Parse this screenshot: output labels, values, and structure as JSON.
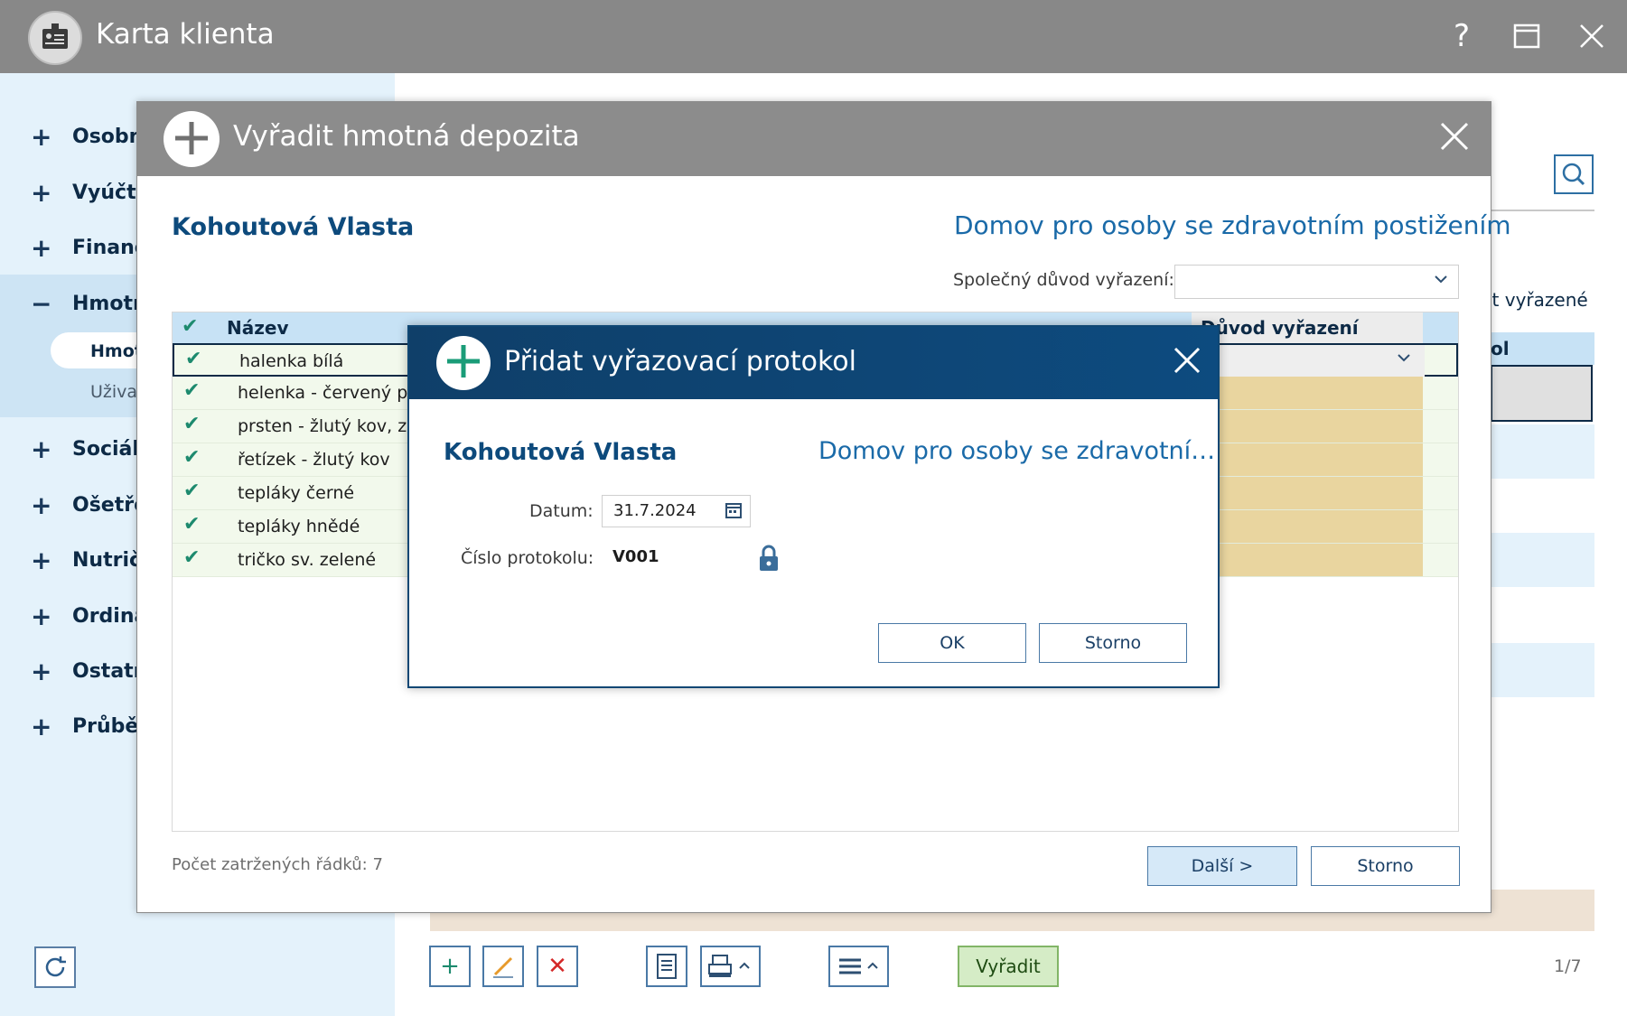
{
  "main_window": {
    "title": "Karta klienta",
    "help_label": "?",
    "maximize_label": "☐",
    "close_label": "✕",
    "pager": "1/7"
  },
  "sidebar": {
    "items": [
      {
        "sign": "+",
        "label": "Osobní"
      },
      {
        "sign": "+",
        "label": "Vyúčto"
      },
      {
        "sign": "+",
        "label": "Finanč"
      },
      {
        "sign": "−",
        "label": "Hmotn"
      },
      {
        "sign": "+",
        "label": "Sociáln"
      },
      {
        "sign": "+",
        "label": "Ošetřo"
      },
      {
        "sign": "+",
        "label": "Nutrič"
      },
      {
        "sign": "+",
        "label": "Ordina"
      },
      {
        "sign": "+",
        "label": "Ostatn"
      },
      {
        "sign": "+",
        "label": "Průběh"
      }
    ],
    "sub_items": [
      "Hmot",
      "Uživat"
    ]
  },
  "background": {
    "right_label": "it vyřazené",
    "right_col": "ol"
  },
  "toolbar": {
    "vyradit_label": "Vyřadit"
  },
  "dialog1": {
    "title": "Vyřadit hmotná depozita",
    "client_name": "Kohoutová Vlasta",
    "facility": "Domov pro osoby se zdravotním postižením",
    "common_reason_label": "Společný důvod vyřazení:",
    "common_reason_value": "",
    "table": {
      "col_name": "Název",
      "col_reason": "Důvod vyřazení",
      "rows": [
        {
          "name": "halenka bílá"
        },
        {
          "name": "helenka - červený pro"
        },
        {
          "name": "prsten - žlutý kov, zel"
        },
        {
          "name": "řetízek - žlutý kov"
        },
        {
          "name": "tepláky černé"
        },
        {
          "name": "tepláky hnědé"
        },
        {
          "name": "tričko sv. zelené"
        }
      ]
    },
    "rows_count": "Počet zatržených řádků: 7",
    "next_label": "Další >",
    "cancel_label": "Storno"
  },
  "dialog2": {
    "title": "Přidat vyřazovací protokol",
    "client_name": "Kohoutová Vlasta",
    "facility": "Domov pro osoby se zdravotní…",
    "date_label": "Datum:",
    "date_value": "31.7.2024",
    "protocol_label": "Číslo protokolu:",
    "protocol_value": "V001",
    "ok_label": "OK",
    "cancel_label": "Storno"
  },
  "colors": {
    "title_gray": "#888888",
    "dialog_blue": "#0f4774",
    "accent_green": "#1d8a6e",
    "reason_cell": "#e9d59f"
  }
}
